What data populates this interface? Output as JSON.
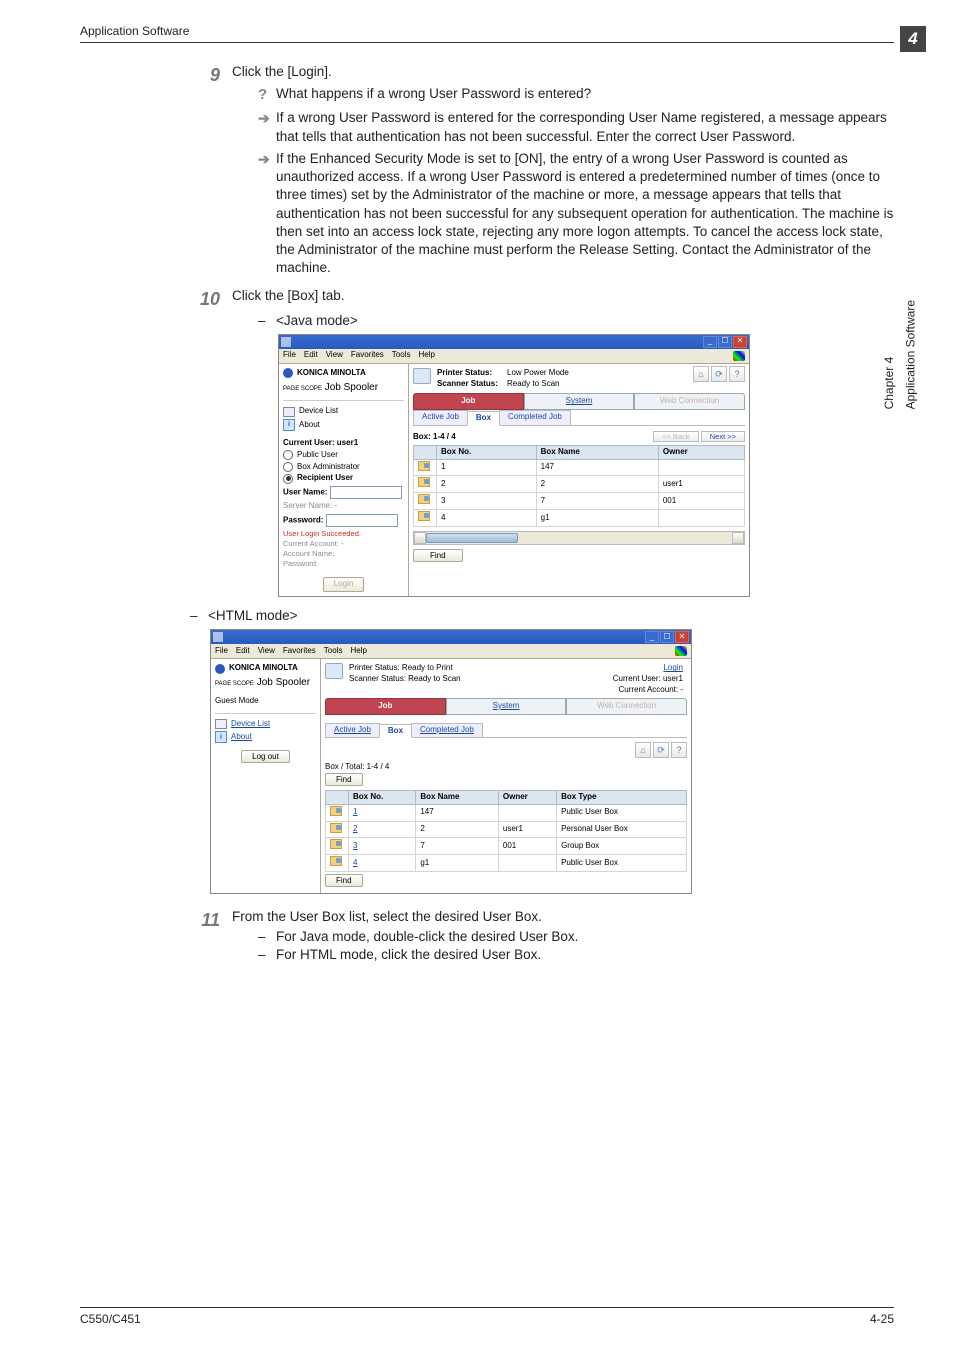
{
  "header": {
    "section": "Application Software",
    "chapter_digit": "4"
  },
  "side": {
    "chapter": "Chapter 4",
    "section": "Application Software"
  },
  "steps": {
    "s9": {
      "num": "9",
      "text": "Click the [Login].",
      "q": "What happens if a wrong User Password is entered?",
      "a1": "If a wrong User Password is entered for the corresponding User Name registered, a message appears that tells that authentication has not been successful. Enter the correct User Password.",
      "a2": "If the Enhanced Security Mode is set to [ON], the entry of a wrong User Password is counted as unauthorized access. If a wrong User Password is entered a predetermined number of times (once to three times) set by the Administrator of the machine or more, a message appears that tells that authentication has not been successful for any subsequent operation for authentication. The machine is then set into an access lock state, rejecting any more logon attempts. To cancel the access lock state, the Administrator of the machine must perform the Release Setting. Contact the Administrator of the machine."
    },
    "s10": {
      "num": "10",
      "text": "Click the [Box] tab.",
      "java_label": "<Java mode>",
      "html_label": "<HTML mode>"
    },
    "s11": {
      "num": "11",
      "text": "From the User Box list, select the desired User Box.",
      "d1": "For Java mode, double-click the desired User Box.",
      "d2": "For HTML mode, click the desired User Box."
    }
  },
  "win": {
    "menu_file": "File",
    "menu_edit": "Edit",
    "menu_view": "View",
    "menu_fav": "Favorites",
    "menu_tools": "Tools",
    "menu_help": "Help"
  },
  "java": {
    "brand": "KONICA MINOLTA",
    "spooler_small": "PAGE SCOPE",
    "spooler": "Job Spooler",
    "device_list": "Device List",
    "about": "About",
    "current_user_label": "Current User: user1",
    "opt_public": "Public User",
    "opt_boxadmin": "Box Administrator",
    "opt_recipient": "Recipient User",
    "user_name_lbl": "User Name:",
    "server_name_lbl": "Server Name:",
    "server_name_val": "-",
    "password_lbl": "Password:",
    "login_ok": "User Login Succeeded.",
    "cur_acct": "Current Account: -",
    "acct_name": "Account Name:",
    "acct_pwd": "Password:",
    "login_btn": "Login",
    "status_printer_k": "Printer Status:",
    "status_printer_v": "Low Power Mode",
    "status_scanner_k": "Scanner Status:",
    "status_scanner_v": "Ready to Scan",
    "tab_job": "Job",
    "tab_system": "System",
    "tab_web": "Web Connection",
    "sub_active": "Active Job",
    "sub_box": "Box",
    "sub_completed": "Completed Job",
    "box_listing": "Box: 1-4 / 4",
    "back_btn": "<< Back",
    "next_btn": "Next >>",
    "col_boxno": "Box No.",
    "col_boxname": "Box Name",
    "col_owner": "Owner",
    "rows": [
      {
        "no": "1",
        "name": "147",
        "owner": ""
      },
      {
        "no": "2",
        "name": "2",
        "owner": "user1"
      },
      {
        "no": "3",
        "name": "7",
        "owner": "001"
      },
      {
        "no": "4",
        "name": "g1",
        "owner": ""
      }
    ],
    "find_btn": "Find"
  },
  "html": {
    "brand": "KONICA MINOLTA",
    "spooler_small": "PAGE SCOPE",
    "spooler": "Job Spooler",
    "guest_mode": "Guest Mode",
    "device_list": "Device List",
    "about": "About",
    "logout": "Log out",
    "login_link": "Login",
    "cur_user": "Current User: user1",
    "cur_acct": "Current Account: -",
    "status_printer": "Printer Status: Ready to Print",
    "status_scanner": "Scanner Status: Ready to Scan",
    "tab_job": "Job",
    "tab_system": "System",
    "tab_web": "Web Connection",
    "sub_active": "Active Job",
    "sub_box": "Box",
    "sub_completed": "Completed Job",
    "listing": "Box / Total: 1-4 / 4",
    "find_btn": "Find",
    "col_boxno": "Box No.",
    "col_boxname": "Box Name",
    "col_owner": "Owner",
    "col_boxtype": "Box Type",
    "rows": [
      {
        "no": "1",
        "name": "147",
        "owner": "",
        "type": "Public User Box"
      },
      {
        "no": "2",
        "name": "2",
        "owner": "user1",
        "type": "Personal User Box"
      },
      {
        "no": "3",
        "name": "7",
        "owner": "001",
        "type": "Group Box"
      },
      {
        "no": "4",
        "name": "g1",
        "owner": "",
        "type": "Public User Box"
      }
    ]
  },
  "footer": {
    "model": "C550/C451",
    "page": "4-25"
  }
}
